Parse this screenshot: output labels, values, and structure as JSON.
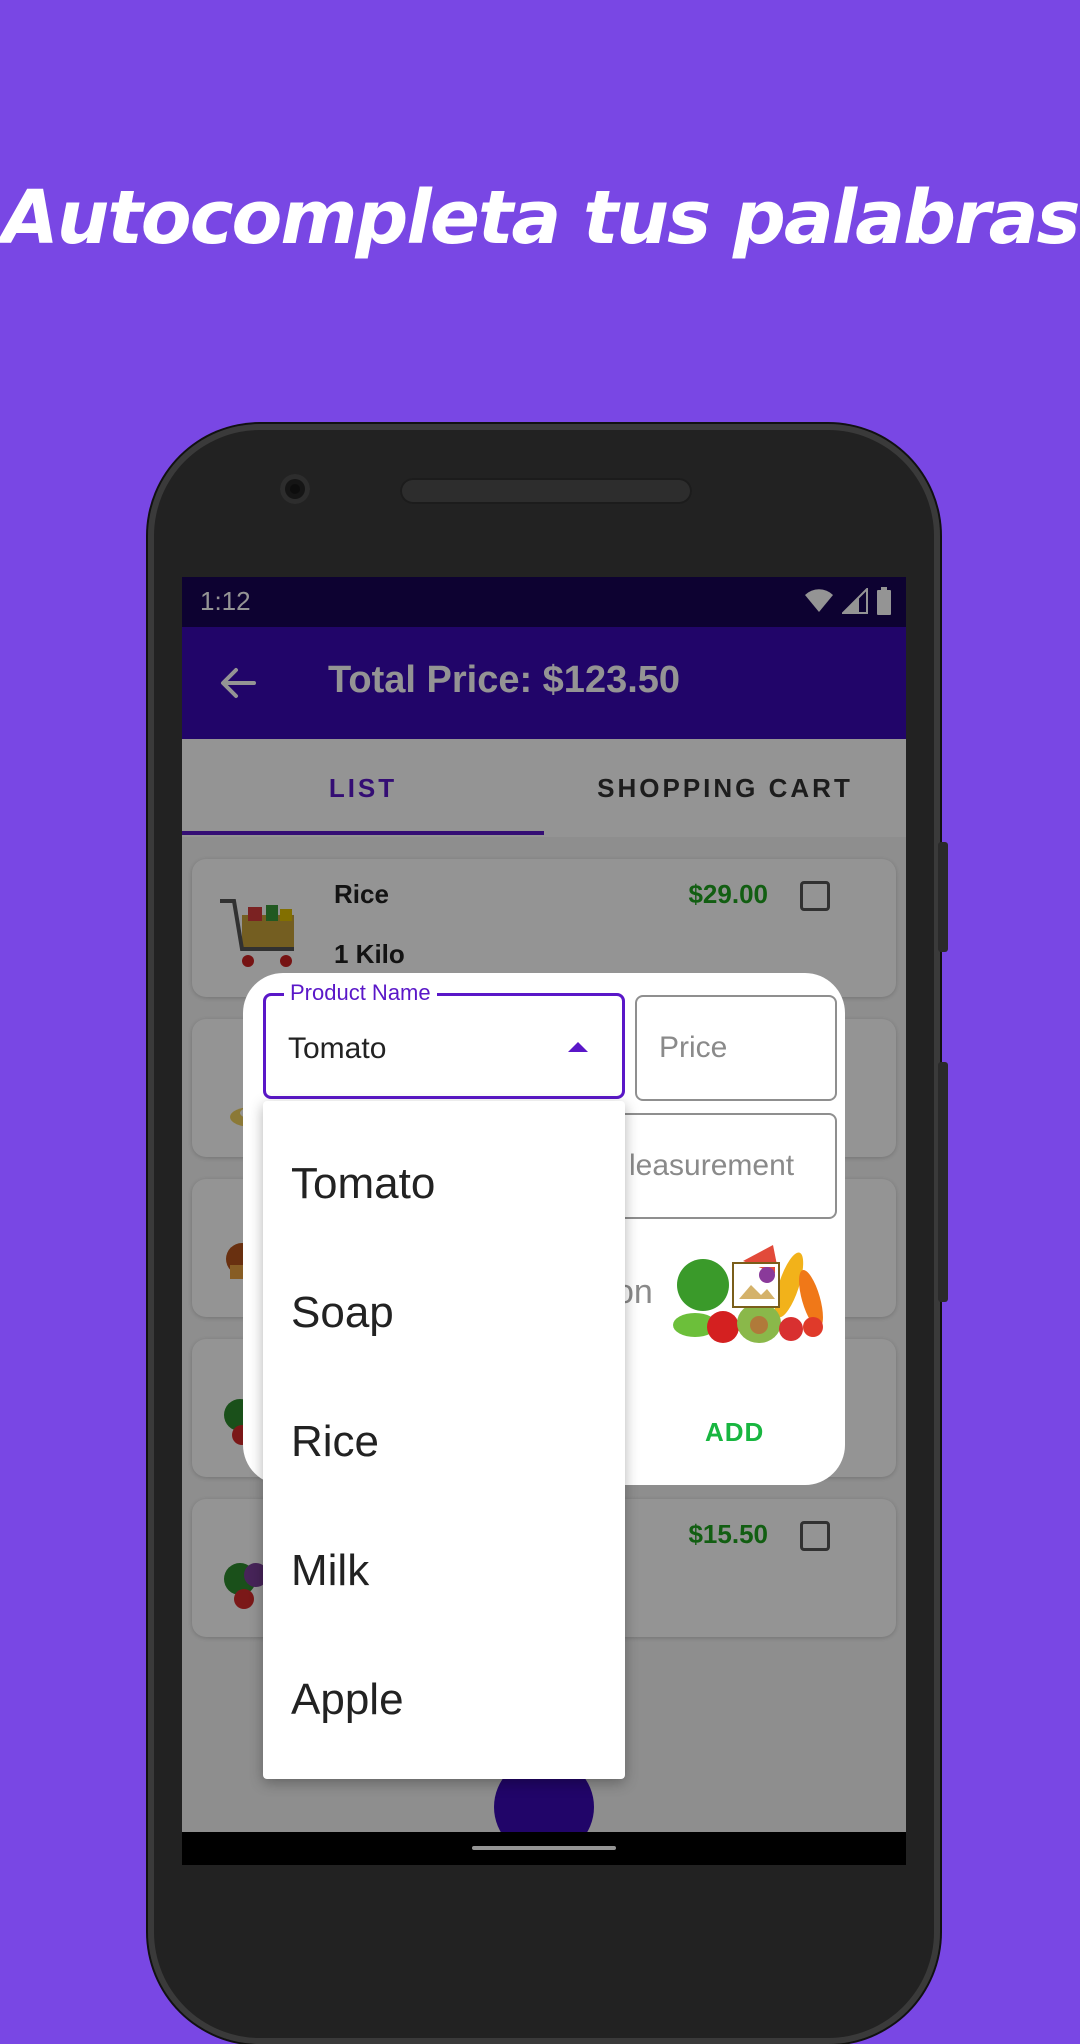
{
  "headline": "Autocompleta tus palabras",
  "status_bar": {
    "time": "1:12"
  },
  "app_bar": {
    "title": "Total Price: $123.50"
  },
  "tabs": [
    {
      "label": "LIST",
      "selected": true
    },
    {
      "label": "SHOPPING CART",
      "selected": false
    }
  ],
  "items": [
    {
      "name": "Rice",
      "quantity": "1 Kilo",
      "price": "$29.00",
      "checked": false
    },
    {
      "name": "",
      "quantity": "",
      "price": "",
      "checked": false
    },
    {
      "name": "",
      "quantity": "",
      "price": "",
      "checked": false
    },
    {
      "name": "",
      "quantity": "",
      "price": "",
      "checked": false
    },
    {
      "name": "",
      "quantity": "",
      "price": "$15.50",
      "checked": false
    }
  ],
  "dialog": {
    "product_name_label": "Product Name",
    "product_name_value": "Tomato",
    "price_placeholder": "Price",
    "measurement_placeholder": "leasurement",
    "icon_label": "con",
    "add_label": "ADD"
  },
  "dropdown": {
    "options": [
      "Tomato",
      "Soap",
      "Rice",
      "Milk",
      "Apple"
    ]
  },
  "colors": {
    "background": "#7947E4",
    "primary": "#3A09B5",
    "accent": "#5a17c8",
    "price_green": "#1fa31f",
    "add_green": "#18b640"
  }
}
